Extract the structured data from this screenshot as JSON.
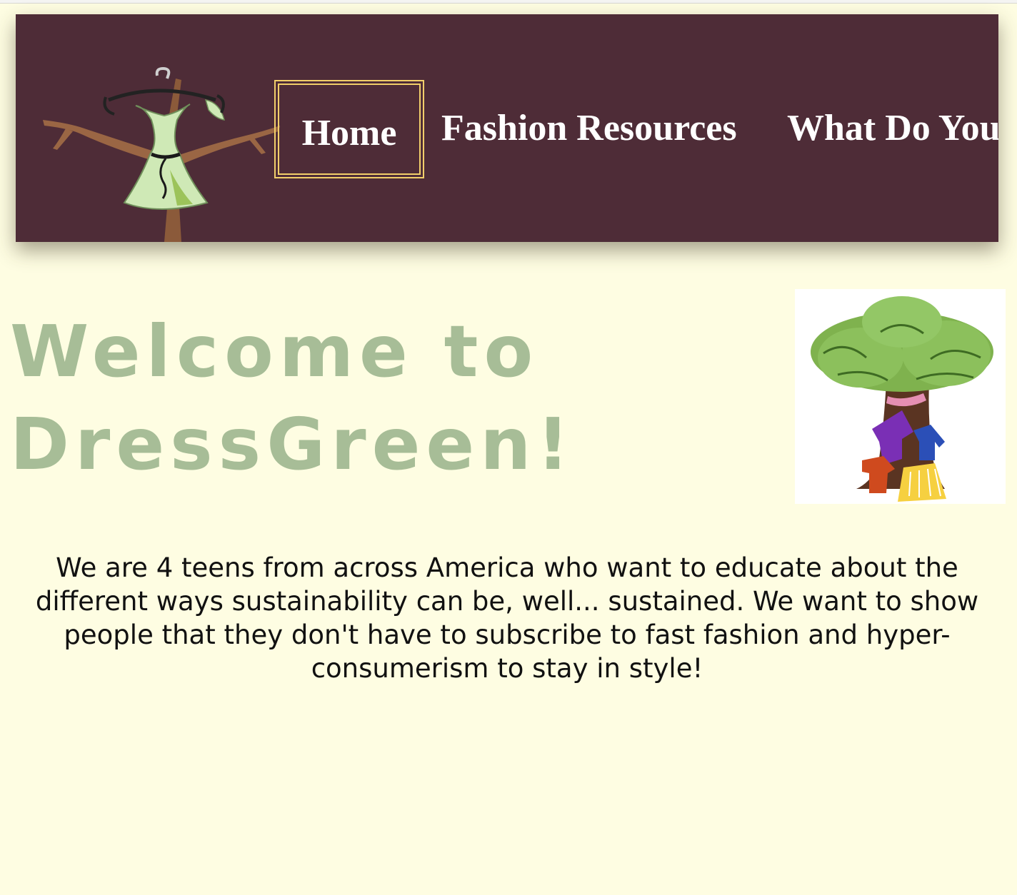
{
  "nav": {
    "logo_icon": "dress-on-tree-logo",
    "items": [
      {
        "label": "Home",
        "active": true
      },
      {
        "label": "Fashion Resources",
        "active": false
      },
      {
        "label": "What Do You",
        "active": false
      }
    ]
  },
  "hero": {
    "title": "Welcome to DressGreen!",
    "image_icon": "tree-with-clothes-illustration"
  },
  "intro": {
    "text": "We are 4 teens from across America who want to educate about the different ways sustainability can be, well... sustained. We want to show people that they don't have to subscribe to fast fashion and hyper-consumerism to stay in style!"
  },
  "colors": {
    "nav_background": "#4e2c37",
    "active_border": "#f2cf6a",
    "page_background": "#fefde2",
    "title_green": "#a7bd97"
  }
}
